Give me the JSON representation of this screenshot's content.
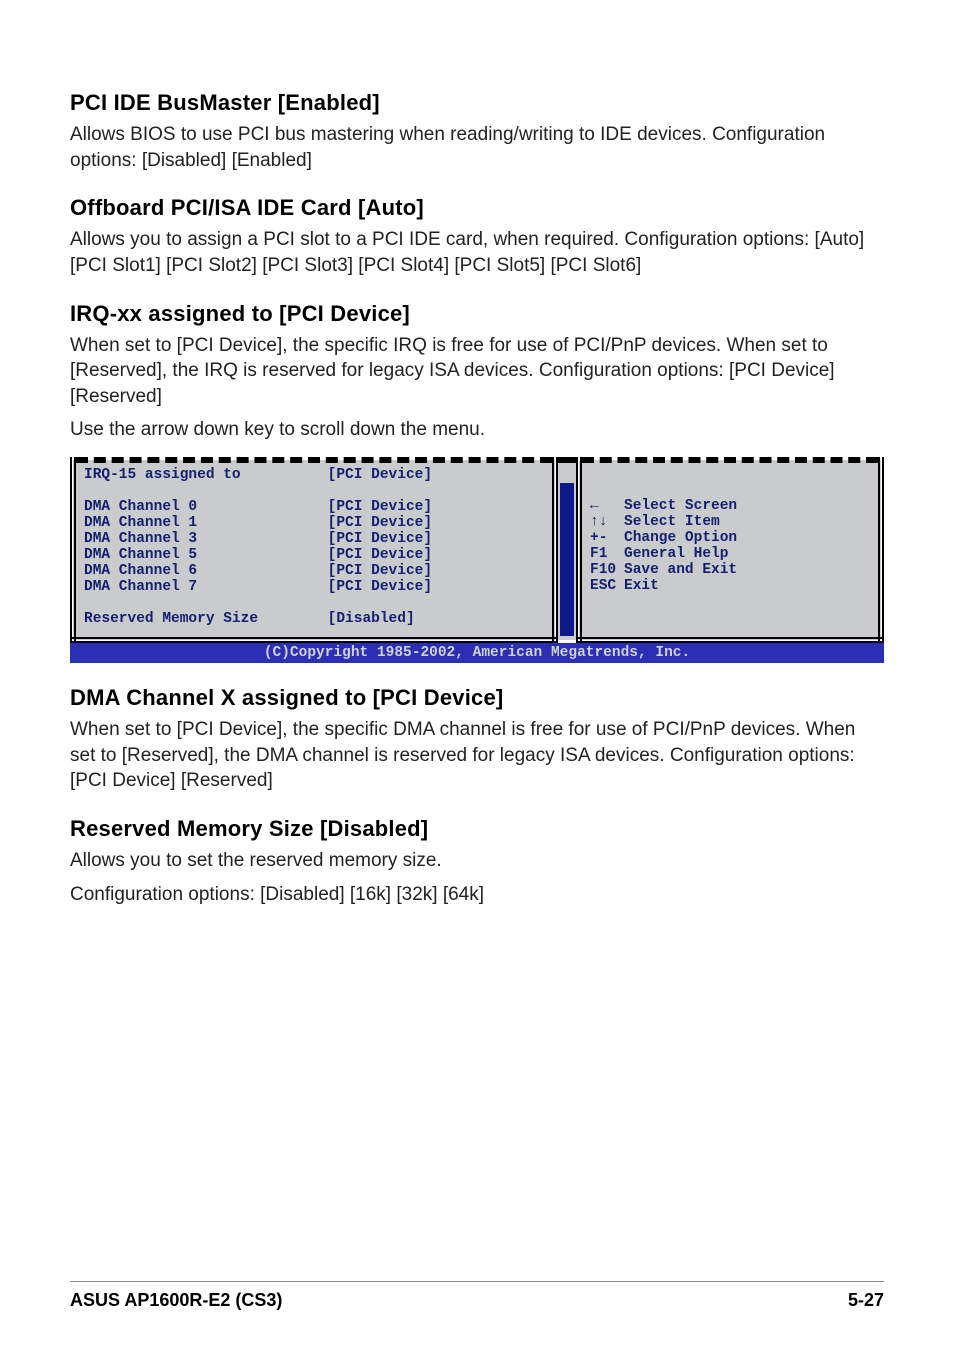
{
  "sections": {
    "pci_ide": {
      "heading": "PCI IDE BusMaster [Enabled]",
      "p1": "Allows BIOS to use PCI bus mastering when reading/writing to IDE devices. Configuration options: [Disabled] [Enabled]"
    },
    "offboard": {
      "heading": "Offboard PCI/ISA IDE Card [Auto]",
      "p1": "Allows you to assign a PCI slot to a PCI IDE card, when required. Configuration options: [Auto] [PCI Slot1] [PCI Slot2] [PCI Slot3] [PCI Slot4] [PCI Slot5] [PCI Slot6]"
    },
    "irq": {
      "heading": "IRQ-xx assigned to [PCI Device]",
      "p1": "When set to [PCI Device], the specific IRQ is free for use of PCI/PnP devices. When set to [Reserved], the IRQ is reserved for legacy ISA devices. Configuration options: [PCI Device] [Reserved]",
      "p2": "Use the arrow down key to scroll down the menu."
    },
    "dma": {
      "heading": "DMA Channel X assigned to [PCI Device]",
      "p1": "When set to [PCI Device], the specific DMA channel is free for use of PCI/PnP devices. When set to [Reserved], the DMA channel is reserved for legacy ISA devices. Configuration options: [PCI Device] [Reserved]"
    },
    "reserved": {
      "heading": "Reserved Memory Size [Disabled]",
      "p1": "Allows you to set the reserved memory size.",
      "p2": "Configuration options: [Disabled] [16k] [32k] [64k]"
    }
  },
  "bios": {
    "rows": [
      {
        "label": "IRQ-15 assigned to",
        "value": "[PCI Device]",
        "gapAfter": true
      },
      {
        "label": "DMA Channel 0",
        "value": "[PCI Device]"
      },
      {
        "label": "DMA Channel 1",
        "value": "[PCI Device]"
      },
      {
        "label": "DMA Channel 3",
        "value": "[PCI Device]"
      },
      {
        "label": "DMA Channel 5",
        "value": "[PCI Device]"
      },
      {
        "label": "DMA Channel 6",
        "value": "[PCI Device]"
      },
      {
        "label": "DMA Channel 7",
        "value": "[PCI Device]",
        "gapAfter": true
      },
      {
        "label": "Reserved Memory Size",
        "value": "[Disabled]"
      }
    ],
    "help": [
      {
        "glyph": "←",
        "text": "Select Screen"
      },
      {
        "glyph": "↑↓",
        "text": "Select Item"
      },
      {
        "glyph": "+-",
        "text": "Change Option"
      },
      {
        "glyph": "F1",
        "text": "General Help"
      },
      {
        "glyph": "F10",
        "text": "Save and Exit"
      },
      {
        "glyph": "ESC",
        "text": "Exit"
      }
    ],
    "copyright": "(C)Copyright 1985-2002, American Megatrends, Inc."
  },
  "footer": {
    "left": "ASUS AP1600R-E2 (CS3)",
    "right": "5-27"
  }
}
